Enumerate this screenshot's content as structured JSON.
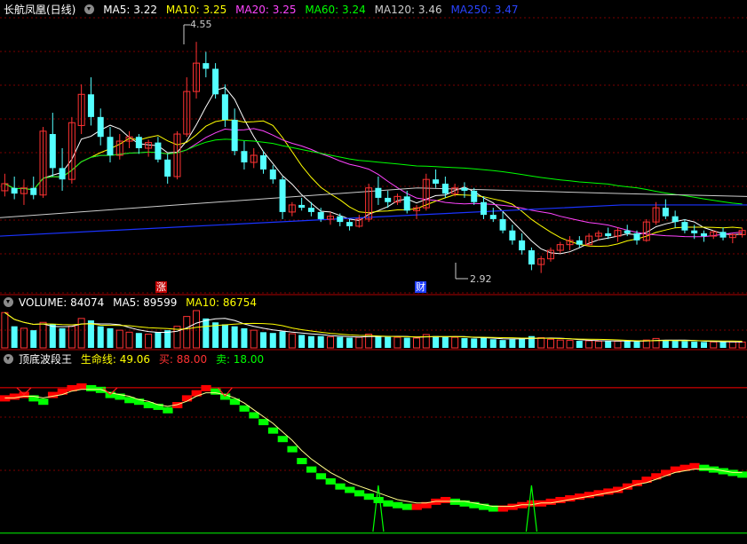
{
  "price_panel": {
    "title": "长航凤凰(日线)",
    "ma": [
      {
        "label": "MA5: 3.22",
        "color": "#ffffff"
      },
      {
        "label": "MA10: 3.25",
        "color": "#ffff00"
      },
      {
        "label": "MA20: 3.25",
        "color": "#ff44ff"
      },
      {
        "label": "MA60: 3.24",
        "color": "#00ff00"
      },
      {
        "label": "MA120: 3.46",
        "color": "#cccccc"
      },
      {
        "label": "MA250: 3.47",
        "color": "#1a33ff"
      }
    ],
    "high_label": "4.55",
    "low_label": "2.92",
    "event_zhang": "涨",
    "event_cai": "财"
  },
  "volume_panel": {
    "title": "VOLUME: 84074",
    "ma5": "MA5: 89599",
    "ma10": "MA10: 86754"
  },
  "indicator_panel": {
    "title": "顶底波段王",
    "life_line": "生命线: 49.06",
    "buy": "买: 88.00",
    "sell": "卖: 18.00"
  },
  "colors": {
    "up": "#ff3232",
    "down": "#54ffff",
    "grid": "#7a0000",
    "ind_up": "#ff0000",
    "ind_down": "#00ff00"
  },
  "chart_data": {
    "type": "candlestick",
    "y_range": [
      2.78,
      4.72
    ],
    "candles": [
      {
        "o": 3.5,
        "h": 3.62,
        "l": 3.46,
        "c": 3.55
      },
      {
        "o": 3.52,
        "h": 3.6,
        "l": 3.44,
        "c": 3.48
      },
      {
        "o": 3.48,
        "h": 3.58,
        "l": 3.4,
        "c": 3.52
      },
      {
        "o": 3.52,
        "h": 3.6,
        "l": 3.44,
        "c": 3.47
      },
      {
        "o": 3.47,
        "h": 3.95,
        "l": 3.45,
        "c": 3.92
      },
      {
        "o": 3.9,
        "h": 4.05,
        "l": 3.6,
        "c": 3.66
      },
      {
        "o": 3.66,
        "h": 3.8,
        "l": 3.5,
        "c": 3.58
      },
      {
        "o": 3.58,
        "h": 4.02,
        "l": 3.55,
        "c": 3.98
      },
      {
        "o": 3.96,
        "h": 4.25,
        "l": 3.9,
        "c": 4.18
      },
      {
        "o": 4.18,
        "h": 4.3,
        "l": 3.96,
        "c": 4.02
      },
      {
        "o": 4.02,
        "h": 4.08,
        "l": 3.82,
        "c": 3.88
      },
      {
        "o": 3.88,
        "h": 3.95,
        "l": 3.7,
        "c": 3.75
      },
      {
        "o": 3.75,
        "h": 3.9,
        "l": 3.72,
        "c": 3.85
      },
      {
        "o": 3.85,
        "h": 3.92,
        "l": 3.8,
        "c": 3.88
      },
      {
        "o": 3.88,
        "h": 3.9,
        "l": 3.76,
        "c": 3.8
      },
      {
        "o": 3.8,
        "h": 3.86,
        "l": 3.74,
        "c": 3.84
      },
      {
        "o": 3.84,
        "h": 3.88,
        "l": 3.7,
        "c": 3.72
      },
      {
        "o": 3.72,
        "h": 3.76,
        "l": 3.55,
        "c": 3.6
      },
      {
        "o": 3.6,
        "h": 3.92,
        "l": 3.58,
        "c": 3.9
      },
      {
        "o": 3.9,
        "h": 4.3,
        "l": 3.88,
        "c": 4.2
      },
      {
        "o": 4.2,
        "h": 4.55,
        "l": 4.15,
        "c": 4.4
      },
      {
        "o": 4.4,
        "h": 4.48,
        "l": 4.3,
        "c": 4.36
      },
      {
        "o": 4.36,
        "h": 4.4,
        "l": 4.15,
        "c": 4.18
      },
      {
        "o": 4.18,
        "h": 4.25,
        "l": 3.95,
        "c": 4.0
      },
      {
        "o": 4.0,
        "h": 4.08,
        "l": 3.75,
        "c": 3.78
      },
      {
        "o": 3.78,
        "h": 3.85,
        "l": 3.65,
        "c": 3.7
      },
      {
        "o": 3.7,
        "h": 3.8,
        "l": 3.66,
        "c": 3.75
      },
      {
        "o": 3.75,
        "h": 3.78,
        "l": 3.62,
        "c": 3.65
      },
      {
        "o": 3.65,
        "h": 3.68,
        "l": 3.55,
        "c": 3.58
      },
      {
        "o": 3.58,
        "h": 3.6,
        "l": 3.3,
        "c": 3.35
      },
      {
        "o": 3.35,
        "h": 3.42,
        "l": 3.32,
        "c": 3.4
      },
      {
        "o": 3.4,
        "h": 3.45,
        "l": 3.36,
        "c": 3.38
      },
      {
        "o": 3.38,
        "h": 3.42,
        "l": 3.32,
        "c": 3.35
      },
      {
        "o": 3.35,
        "h": 3.38,
        "l": 3.28,
        "c": 3.3
      },
      {
        "o": 3.3,
        "h": 3.35,
        "l": 3.26,
        "c": 3.32
      },
      {
        "o": 3.32,
        "h": 3.34,
        "l": 3.25,
        "c": 3.28
      },
      {
        "o": 3.28,
        "h": 3.3,
        "l": 3.22,
        "c": 3.25
      },
      {
        "o": 3.25,
        "h": 3.33,
        "l": 3.24,
        "c": 3.3
      },
      {
        "o": 3.3,
        "h": 3.55,
        "l": 3.28,
        "c": 3.52
      },
      {
        "o": 3.52,
        "h": 3.6,
        "l": 3.4,
        "c": 3.45
      },
      {
        "o": 3.45,
        "h": 3.5,
        "l": 3.38,
        "c": 3.42
      },
      {
        "o": 3.42,
        "h": 3.48,
        "l": 3.4,
        "c": 3.46
      },
      {
        "o": 3.46,
        "h": 3.5,
        "l": 3.34,
        "c": 3.36
      },
      {
        "o": 3.36,
        "h": 3.4,
        "l": 3.3,
        "c": 3.38
      },
      {
        "o": 3.38,
        "h": 3.62,
        "l": 3.36,
        "c": 3.58
      },
      {
        "o": 3.58,
        "h": 3.65,
        "l": 3.52,
        "c": 3.55
      },
      {
        "o": 3.55,
        "h": 3.6,
        "l": 3.45,
        "c": 3.48
      },
      {
        "o": 3.48,
        "h": 3.55,
        "l": 3.46,
        "c": 3.52
      },
      {
        "o": 3.52,
        "h": 3.56,
        "l": 3.45,
        "c": 3.5
      },
      {
        "o": 3.5,
        "h": 3.52,
        "l": 3.4,
        "c": 3.42
      },
      {
        "o": 3.42,
        "h": 3.46,
        "l": 3.3,
        "c": 3.33
      },
      {
        "o": 3.33,
        "h": 3.38,
        "l": 3.28,
        "c": 3.3
      },
      {
        "o": 3.3,
        "h": 3.35,
        "l": 3.2,
        "c": 3.22
      },
      {
        "o": 3.22,
        "h": 3.26,
        "l": 3.12,
        "c": 3.15
      },
      {
        "o": 3.15,
        "h": 3.2,
        "l": 3.05,
        "c": 3.08
      },
      {
        "o": 3.08,
        "h": 3.1,
        "l": 2.94,
        "c": 2.98
      },
      {
        "o": 2.98,
        "h": 3.04,
        "l": 2.92,
        "c": 3.02
      },
      {
        "o": 3.02,
        "h": 3.1,
        "l": 3.0,
        "c": 3.08
      },
      {
        "o": 3.08,
        "h": 3.14,
        "l": 3.06,
        "c": 3.12
      },
      {
        "o": 3.12,
        "h": 3.18,
        "l": 3.08,
        "c": 3.15
      },
      {
        "o": 3.15,
        "h": 3.18,
        "l": 3.1,
        "c": 3.12
      },
      {
        "o": 3.12,
        "h": 3.2,
        "l": 3.11,
        "c": 3.18
      },
      {
        "o": 3.18,
        "h": 3.22,
        "l": 3.15,
        "c": 3.2
      },
      {
        "o": 3.2,
        "h": 3.24,
        "l": 3.16,
        "c": 3.18
      },
      {
        "o": 3.18,
        "h": 3.24,
        "l": 3.14,
        "c": 3.22
      },
      {
        "o": 3.22,
        "h": 3.26,
        "l": 3.18,
        "c": 3.2
      },
      {
        "o": 3.2,
        "h": 3.22,
        "l": 3.12,
        "c": 3.15
      },
      {
        "o": 3.15,
        "h": 3.3,
        "l": 3.14,
        "c": 3.28
      },
      {
        "o": 3.28,
        "h": 3.42,
        "l": 3.26,
        "c": 3.38
      },
      {
        "o": 3.38,
        "h": 3.44,
        "l": 3.3,
        "c": 3.32
      },
      {
        "o": 3.32,
        "h": 3.36,
        "l": 3.24,
        "c": 3.28
      },
      {
        "o": 3.28,
        "h": 3.3,
        "l": 3.2,
        "c": 3.22
      },
      {
        "o": 3.22,
        "h": 3.26,
        "l": 3.16,
        "c": 3.2
      },
      {
        "o": 3.2,
        "h": 3.22,
        "l": 3.14,
        "c": 3.18
      },
      {
        "o": 3.18,
        "h": 3.22,
        "l": 3.16,
        "c": 3.21
      },
      {
        "o": 3.21,
        "h": 3.24,
        "l": 3.15,
        "c": 3.17
      },
      {
        "o": 3.17,
        "h": 3.2,
        "l": 3.13,
        "c": 3.19
      },
      {
        "o": 3.19,
        "h": 3.24,
        "l": 3.17,
        "c": 3.22
      }
    ],
    "volume": [
      0.9,
      0.55,
      0.5,
      0.45,
      0.65,
      0.6,
      0.5,
      0.55,
      0.75,
      0.7,
      0.55,
      0.5,
      0.45,
      0.4,
      0.38,
      0.35,
      0.4,
      0.45,
      0.55,
      0.8,
      0.95,
      0.75,
      0.65,
      0.6,
      0.55,
      0.5,
      0.45,
      0.4,
      0.38,
      0.42,
      0.36,
      0.33,
      0.3,
      0.3,
      0.28,
      0.28,
      0.26,
      0.27,
      0.35,
      0.3,
      0.28,
      0.27,
      0.26,
      0.25,
      0.34,
      0.3,
      0.28,
      0.27,
      0.25,
      0.24,
      0.26,
      0.22,
      0.2,
      0.22,
      0.25,
      0.3,
      0.26,
      0.22,
      0.2,
      0.19,
      0.18,
      0.18,
      0.17,
      0.17,
      0.17,
      0.18,
      0.16,
      0.2,
      0.24,
      0.2,
      0.18,
      0.17,
      0.16,
      0.15,
      0.15,
      0.15,
      0.15,
      0.15
    ],
    "indicator": [
      82,
      83,
      84,
      82,
      80,
      84,
      86,
      88,
      89,
      88,
      87,
      84,
      83,
      81,
      80,
      78,
      77,
      75,
      78,
      82,
      85,
      88,
      86,
      83,
      80,
      76,
      72,
      68,
      63,
      58,
      52,
      45,
      40,
      36,
      33,
      30,
      28,
      26,
      24,
      22,
      20,
      19,
      18,
      18,
      19,
      21,
      22,
      21,
      20,
      19,
      18,
      17,
      17,
      18,
      19,
      20,
      20,
      21,
      22,
      23,
      24,
      25,
      26,
      27,
      28,
      30,
      32,
      34,
      36,
      38,
      40,
      41,
      42,
      41,
      40,
      39,
      38,
      37
    ],
    "life_line": [
      82,
      82,
      83,
      83,
      82,
      83,
      84,
      86,
      87,
      87,
      87,
      85,
      84,
      83,
      81,
      80,
      78,
      77,
      78,
      80,
      83,
      85,
      85,
      84,
      82,
      79,
      75,
      71,
      67,
      62,
      57,
      51,
      46,
      42,
      38,
      35,
      32,
      30,
      28,
      26,
      24,
      22,
      21,
      20,
      20,
      21,
      21,
      21,
      21,
      20,
      19,
      18,
      18,
      18,
      19,
      19,
      20,
      20,
      21,
      22,
      23,
      24,
      25,
      26,
      27,
      29,
      31,
      32,
      34,
      36,
      38,
      39,
      40,
      40,
      40,
      39,
      38,
      38
    ],
    "spikes": [
      {
        "i": 2,
        "v": 93
      },
      {
        "i": 11,
        "v": 93
      },
      {
        "i": 23,
        "v": 93
      },
      {
        "i": 39,
        "v": 30
      },
      {
        "i": 55,
        "v": 30
      }
    ]
  }
}
